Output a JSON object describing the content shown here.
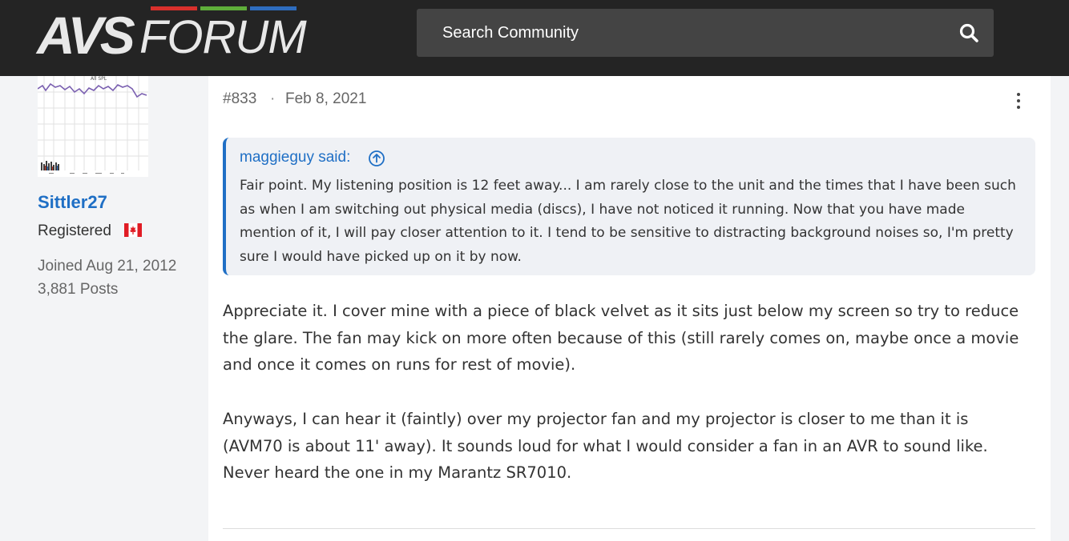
{
  "site": {
    "logo_avs": "AVS",
    "logo_forum": "FORUM",
    "stripe_colors": [
      "#d9302c",
      "#5fae3a",
      "#2e6dbf"
    ]
  },
  "search": {
    "placeholder": "Search Community",
    "icon": "search-icon"
  },
  "user": {
    "name": "Sittler27",
    "role": "Registered",
    "flag": "canada-flag",
    "joined": "Joined Aug 21, 2012",
    "posts": "3,881 Posts",
    "avatar_caption": "All SPL"
  },
  "post": {
    "number": "#833",
    "separator": "·",
    "date": "Feb 8, 2021",
    "menu_icon": "more-vertical-icon",
    "quote": {
      "author": "maggieguy said:",
      "icon": "arrow-up-circle-icon",
      "text": "Fair point. My listening position is 12 feet away... I am rarely close to the unit and the times that I have been such as when I am switching out physical media (discs), I have not noticed it running. Now that you have made mention of it, I will pay closer attention to it. I tend to be sensitive to distracting background noises so, I'm pretty sure I would have picked up on it by now."
    },
    "paragraphs": [
      "Appreciate it. I cover mine with a piece of black velvet as it sits just below my screen so try to reduce the glare. The fan may kick on more often because of this (still rarely comes on, maybe once a movie and once it comes on runs for rest of movie).",
      "Anyways, I can hear it (faintly) over my projector fan and my projector is closer to me than it is (AVM70 is about 11' away). It sounds loud for what I would consider a fan in an AVR to sound like. Never heard the one in my Marantz SR7010."
    ]
  },
  "colors": {
    "accent": "#1f6fc5",
    "header_bg": "#242424",
    "search_bg": "#444444"
  }
}
